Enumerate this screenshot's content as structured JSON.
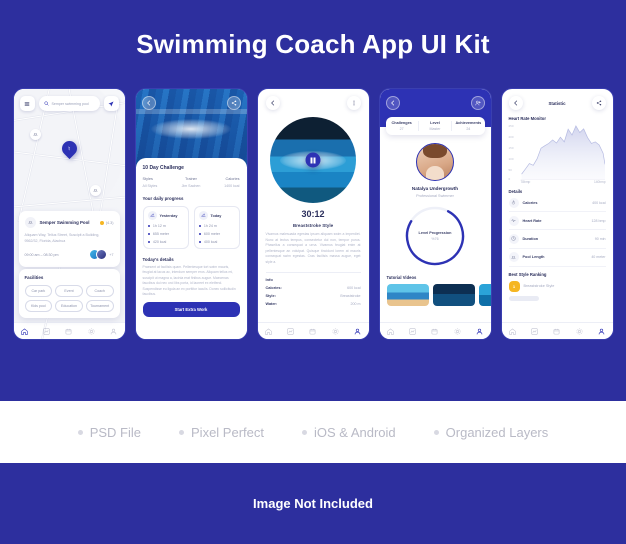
{
  "hero": {
    "title": "Swimming Coach App UI Kit"
  },
  "theme": {
    "primary": "#2d32b4",
    "background": "#2d2f9e",
    "band_bg": "#ffffff",
    "muted_text": "#a6abc2",
    "accent_gold": "#f5b623"
  },
  "screens": {
    "map": {
      "search_placeholder": "Semper swimming pool",
      "icons": {
        "menu": "menu-icon",
        "search": "search-icon",
        "navigate": "navigate-icon",
        "pin": "map-pin-icon"
      },
      "place": {
        "name": "Semper Swimming Pool",
        "rating": "(4.3)",
        "address": "Aliquam Way, Tellus Street, Suscipit a Building, 9562/32, Florida, Alachua",
        "hours": "09:00 am – 08:30 pm",
        "extra_members": "+7"
      },
      "facilities": {
        "heading": "Facilities",
        "chips": [
          "Car park",
          "Event",
          "Coach",
          "Kids pool",
          "Education",
          "Tournament"
        ]
      }
    },
    "challenge": {
      "title": "10 Day Challenge",
      "meta": [
        {
          "key": "Styles",
          "value": "All Styles"
        },
        {
          "key": "Trainer",
          "value": "Jim Sachen"
        },
        {
          "key": "Calories",
          "value": "1400 kcal"
        }
      ],
      "progress_heading": "Your daily progress",
      "cards": [
        {
          "label": "Yesterday",
          "stats": [
            "1h 12 m",
            "655 meter",
            "420 kcal"
          ]
        },
        {
          "label": "Today",
          "stats": [
            "1h 24 m",
            "600 meter",
            "400 kcal"
          ]
        }
      ],
      "details_heading": "Today's details",
      "details_text": "Praesent at facilisis quam. Pellentesque tort swim mauris, feugiat at lacus ac, interdum semper eros. Aliquam tellus mi, suscipit ut magna a, lacinia erat finibus augue. Maecenas faucibus dui nec orci libs porta, id laoreet ex eleifend. Suspendisse eu ligula an ex porttitor iaculis. Donec sollicitudin faucibus.",
      "cta": "Start Extra Work"
    },
    "player": {
      "time": "30:12",
      "style": "Breaststroke Style",
      "description": "Vivamus malesuada egestas ipsum aliquam swim a imperdiet. Nunc at lectus tempus, consectetur dui non, tempor purus. Phasellus a consequat a urna. Vivamus feugiat enim at pellentesque an volutpat. Quisque tincidunt lorem at mauris consequat swim egestas. Cras facilisis massa augue, eget style a.",
      "info_heading": "Info",
      "info": [
        {
          "key": "Calories:",
          "value": "600 kcal"
        },
        {
          "key": "Style:",
          "value": "Breaststroke"
        },
        {
          "key": "Water:",
          "value": "200 m"
        }
      ],
      "icons": {
        "back": "back-arrow-icon",
        "more": "more-vertical-icon",
        "play": "pause-icon"
      }
    },
    "profile": {
      "stats": [
        {
          "key": "Challenges",
          "value": "27"
        },
        {
          "key": "Level",
          "value": "Master"
        },
        {
          "key": "Achievements",
          "value": "24"
        }
      ],
      "name": "Natalya Undergrowth",
      "role": "Professional Swimmer",
      "ring": {
        "label": "Level Progression",
        "value": "%76",
        "percent": 76
      },
      "tutorial_heading": "Tutorial Videos",
      "icons": {
        "back": "back-arrow-icon",
        "add_user": "add-user-icon"
      }
    },
    "statistic": {
      "title": "Statistic",
      "chart_heading": "Heart Rate Monitor",
      "details_heading": "Details",
      "details": [
        {
          "icon": "flame-icon",
          "key": "Calories",
          "value": "400 kcal"
        },
        {
          "icon": "pulse-icon",
          "key": "Heart Rate",
          "value": "128 bmp"
        },
        {
          "icon": "clock-icon",
          "key": "Duration",
          "value": "90 min"
        },
        {
          "icon": "pool-icon",
          "key": "Pool Length",
          "value": "40 meter"
        }
      ],
      "ranking_heading": "Best Style Ranking",
      "ranking": [
        {
          "rank": "1",
          "name": "Breaststroke Style"
        }
      ],
      "icons": {
        "back": "back-arrow-icon",
        "share": "share-icon"
      }
    }
  },
  "chart_data": {
    "type": "area",
    "title": "Heart Rate Monitor",
    "xlabel": "",
    "ylabel": "",
    "ylim": [
      0,
      250
    ],
    "yticks": [
      "250",
      "200",
      "150",
      "100",
      "50",
      "0"
    ],
    "xtick_labels": [
      "78bmp",
      "140bmp"
    ],
    "grid": false,
    "x": [
      0,
      1,
      2,
      3,
      4,
      5,
      6,
      7,
      8,
      9,
      10,
      11,
      12,
      13,
      14,
      15,
      16,
      17,
      18,
      19,
      20,
      21,
      22
    ],
    "values": [
      8,
      30,
      52,
      45,
      72,
      118,
      130,
      142,
      160,
      140,
      168,
      145,
      205,
      175,
      238,
      196,
      215,
      150,
      120,
      128,
      112,
      70,
      22
    ],
    "series": [
      {
        "name": "Heart Rate",
        "values": [
          8,
          30,
          52,
          45,
          72,
          118,
          130,
          142,
          160,
          140,
          168,
          145,
          205,
          175,
          238,
          196,
          215,
          150,
          120,
          128,
          112,
          70,
          22
        ]
      }
    ],
    "legend_position": "none"
  },
  "features": [
    {
      "label": "PSD File"
    },
    {
      "label": "Pixel Perfect"
    },
    {
      "label": "iOS & Android"
    },
    {
      "label": "Organized Layers"
    }
  ],
  "footer": {
    "note": "Image Not Included"
  }
}
